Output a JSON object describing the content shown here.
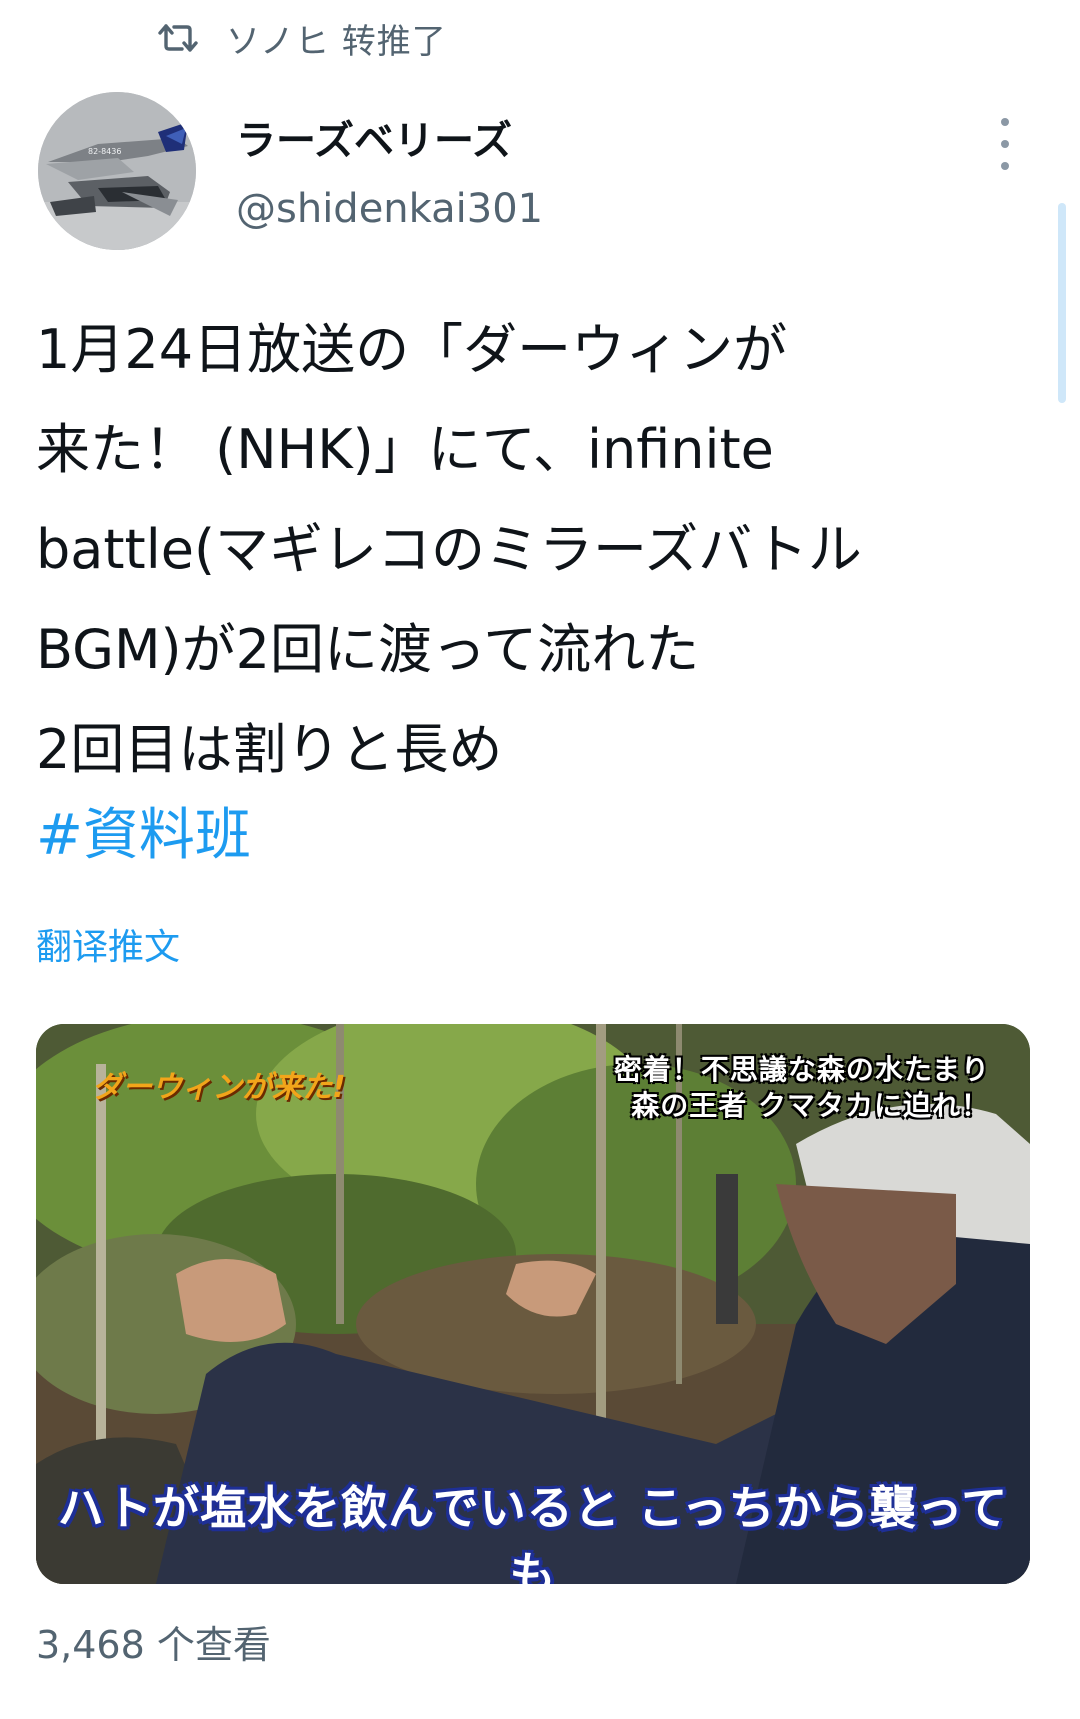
{
  "retweet": {
    "icon": "retweet-icon",
    "text": "ソノヒ 转推了"
  },
  "author": {
    "display_name": "ラーズベリーズ",
    "handle": "@shidenkai301",
    "avatar": "avatar-jet-image"
  },
  "tweet": {
    "lines": [
      "1月24日放送の「ダーウィンが",
      "来た！ (NHK)」にて、infinite",
      "battle(マギレコのミラーズバトル",
      "BGM)が2回に渡って流れた",
      "2回目は割りと長め"
    ],
    "hashtag": "#資料班",
    "translate_label": "翻译推文"
  },
  "media": {
    "logo_text": "ダーウィンが来た!",
    "caption_top": [
      "密着！不思議な森の水たまり",
      "森の王者 クマタカに迫れ！"
    ],
    "subtitle": "ハトが塩水を飲んでいると こっちから襲っても"
  },
  "views": "3,468 个查看",
  "colors": {
    "accent": "#1d9bf0",
    "secondary_text": "#536471",
    "primary_text": "#0f1419"
  }
}
